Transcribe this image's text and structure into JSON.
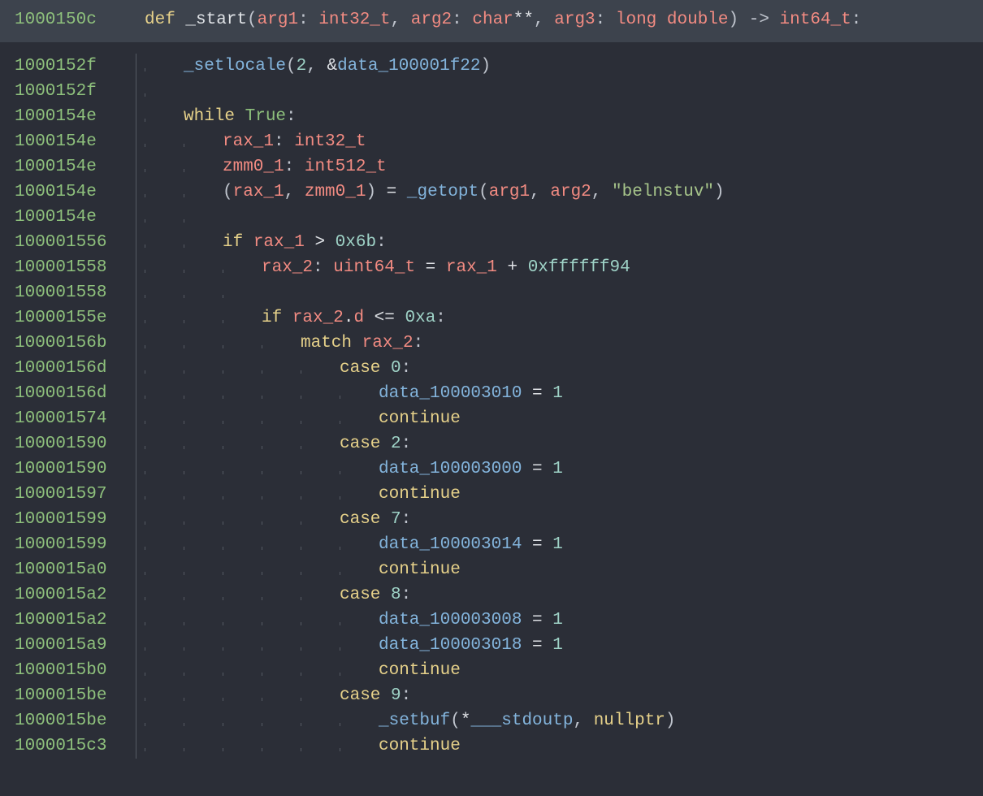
{
  "addresses": [
    "1000150c",
    "1000152f",
    "1000152f",
    "1000154e",
    "1000154e",
    "1000154e",
    "1000154e",
    "1000154e",
    "100001556",
    "100001558",
    "100001558",
    "10000155e",
    "10000156b",
    "10000156d",
    "10000156d",
    "100001574",
    "100001590",
    "100001590",
    "100001597",
    "100001599",
    "100001599",
    "1000015a0",
    "1000015a2",
    "1000015a2",
    "1000015a9",
    "1000015b0",
    "1000015be",
    "1000015be",
    "1000015c3"
  ],
  "header": {
    "def": "def",
    "func": "_start",
    "lp": "(",
    "arg1": "arg1",
    "colon1": ": ",
    "t1": "int32_t",
    "comma1": ", ",
    "arg2": "arg2",
    "colon2": ": ",
    "t2a": "char",
    "t2b": "**",
    "comma2": ", ",
    "arg3": "arg3",
    "colon3": ": ",
    "t3": "long double",
    "rp": ")",
    "arrow": " -> ",
    "ret": "int64_t",
    "end": ":"
  },
  "l1": {
    "fn": "_setlocale",
    "lp": "(",
    "n": "2",
    "c": ", ",
    "amp": "&",
    "id": "data_100001f22",
    "rp": ")"
  },
  "l3": {
    "kw": "while",
    "sp": " ",
    "lit": "True",
    "end": ":"
  },
  "l4": {
    "v": "rax_1",
    "c": ": ",
    "t": "int32_t"
  },
  "l5": {
    "v": "zmm0_1",
    "c": ": ",
    "t": "int512_t"
  },
  "l6": {
    "lp": "(",
    "v1": "rax_1",
    "c1": ", ",
    "v2": "zmm0_1",
    "rp": ")",
    "eq": " = ",
    "fn": "_getopt",
    "lp2": "(",
    "a1": "arg1",
    "c2": ", ",
    "a2": "arg2",
    "c3": ", ",
    "s": "\"belnstuv\"",
    "rp2": ")"
  },
  "l8": {
    "kw": "if",
    "sp": " ",
    "v": "rax_1",
    "op": " > ",
    "n": "0x6b",
    "end": ":"
  },
  "l9": {
    "v": "rax_2",
    "c": ": ",
    "t": "uint64_t",
    "eq": " = ",
    "v2": "rax_1",
    "op": " + ",
    "n": "0xffffff94"
  },
  "l11": {
    "kw": "if",
    "sp": " ",
    "v": "rax_2",
    "dot": ".",
    "fld": "d",
    "op": " <= ",
    "n": "0xa",
    "end": ":"
  },
  "l12": {
    "kw": "match",
    "sp": " ",
    "v": "rax_2",
    "end": ":"
  },
  "case0": {
    "kw": "case",
    "sp": " ",
    "n": "0",
    "end": ":"
  },
  "case0b": {
    "id": "data_100003010",
    "eq": " = ",
    "n": "1"
  },
  "cont": {
    "kw": "continue"
  },
  "case2": {
    "kw": "case",
    "sp": " ",
    "n": "2",
    "end": ":"
  },
  "case2b": {
    "id": "data_100003000",
    "eq": " = ",
    "n": "1"
  },
  "case7": {
    "kw": "case",
    "sp": " ",
    "n": "7",
    "end": ":"
  },
  "case7b": {
    "id": "data_100003014",
    "eq": " = ",
    "n": "1"
  },
  "case8": {
    "kw": "case",
    "sp": " ",
    "n": "8",
    "end": ":"
  },
  "case8b": {
    "id": "data_100003008",
    "eq": " = ",
    "n": "1"
  },
  "case8c": {
    "id": "data_100003018",
    "eq": " = ",
    "n": "1"
  },
  "case9": {
    "kw": "case",
    "sp": " ",
    "n": "9",
    "end": ":"
  },
  "case9b": {
    "fn": "_setbuf",
    "lp": "(",
    "star": "*",
    "id": "___stdoutp",
    "c": ", ",
    "np": "nullptr",
    "rp": ")"
  }
}
